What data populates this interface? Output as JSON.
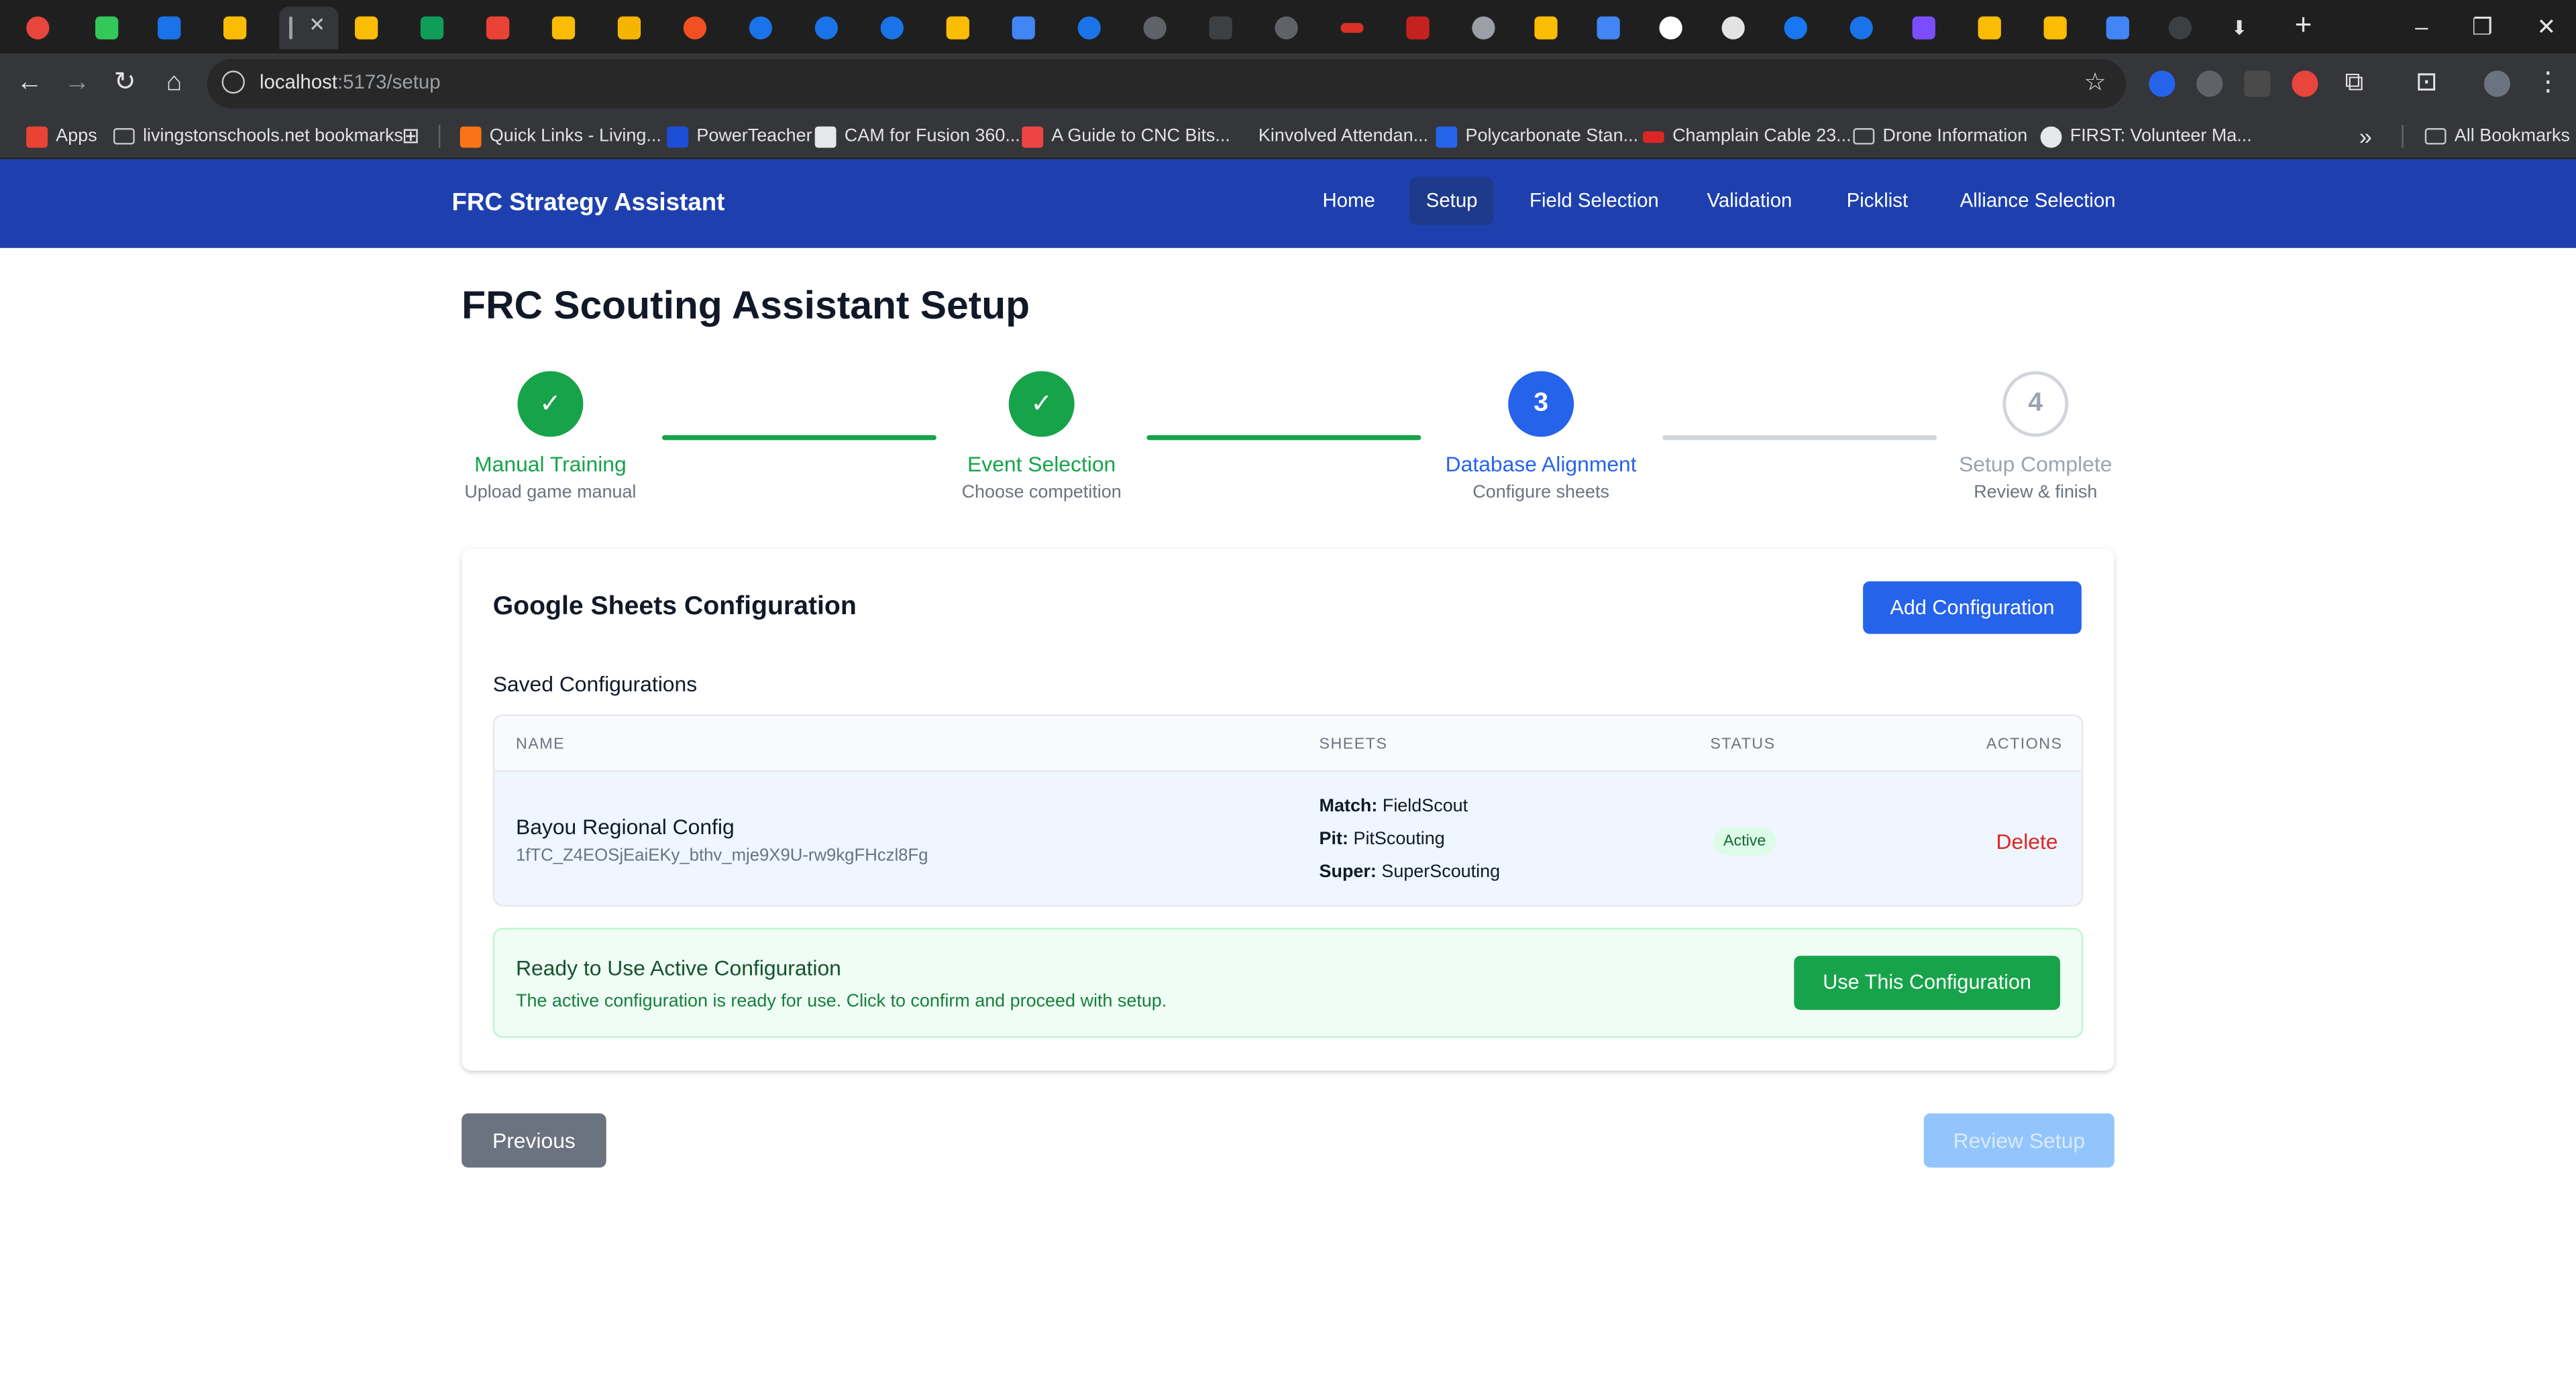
{
  "browser": {
    "url_host": "localhost",
    "url_path": ":5173/setup",
    "active_tab_close": "✕",
    "new_tab": "+",
    "bookmarks": [
      {
        "label": "Apps"
      },
      {
        "label": "livingstonschools.net bookmarks"
      },
      {
        "label": "Quick Links - Living..."
      },
      {
        "label": "PowerTeacher"
      },
      {
        "label": "CAM for Fusion 360..."
      },
      {
        "label": "A Guide to CNC Bits..."
      },
      {
        "label": "Kinvolved Attendan..."
      },
      {
        "label": "Polycarbonate Stan..."
      },
      {
        "label": "Champlain Cable 23..."
      },
      {
        "label": "Drone Information"
      },
      {
        "label": "FIRST: Volunteer Ma..."
      },
      {
        "label": "All Bookmarks"
      }
    ],
    "bookmarks_overflow": "»"
  },
  "app": {
    "brand": "FRC Strategy Assistant",
    "nav": [
      {
        "label": "Home"
      },
      {
        "label": "Setup"
      },
      {
        "label": "Field Selection"
      },
      {
        "label": "Validation"
      },
      {
        "label": "Picklist"
      },
      {
        "label": "Alliance Selection"
      }
    ],
    "current_nav": "Setup"
  },
  "page": {
    "title": "FRC Scouting Assistant Setup"
  },
  "steps": [
    {
      "marker": "✓",
      "label": "Manual Training",
      "sub": "Upload game manual",
      "state": "done"
    },
    {
      "marker": "✓",
      "label": "Event Selection",
      "sub": "Choose competition",
      "state": "done"
    },
    {
      "marker": "3",
      "label": "Database Alignment",
      "sub": "Configure sheets",
      "state": "current"
    },
    {
      "marker": "4",
      "label": "Setup Complete",
      "sub": "Review & finish",
      "state": "todo"
    }
  ],
  "config_card": {
    "title": "Google Sheets Configuration",
    "add_button": "Add Configuration",
    "saved_title": "Saved Configurations",
    "columns": {
      "name": "NAME",
      "sheets": "SHEETS",
      "status": "STATUS",
      "actions": "ACTIONS"
    },
    "rows": [
      {
        "name": "Bayou Regional Config",
        "id": "1fTC_Z4EOSjEaiEKy_bthv_mje9X9U-rw9kgFHczl8Fg",
        "sheets": [
          {
            "key": "Match:",
            "value": "FieldScout"
          },
          {
            "key": "Pit:",
            "value": "PitScouting"
          },
          {
            "key": "Super:",
            "value": "SuperScouting"
          }
        ],
        "status": "Active",
        "action": "Delete"
      }
    ],
    "ready": {
      "title": "Ready to Use Active Configuration",
      "text": "The active configuration is ready for use. Click to confirm and proceed with setup.",
      "button": "Use This Configuration"
    }
  },
  "footer_nav": {
    "previous": "Previous",
    "review": "Review Setup"
  },
  "colors": {
    "header": "#1e40af",
    "done": "#16a34a",
    "current": "#2563eb",
    "todo": "#9ca3af",
    "danger": "#dc2626"
  }
}
